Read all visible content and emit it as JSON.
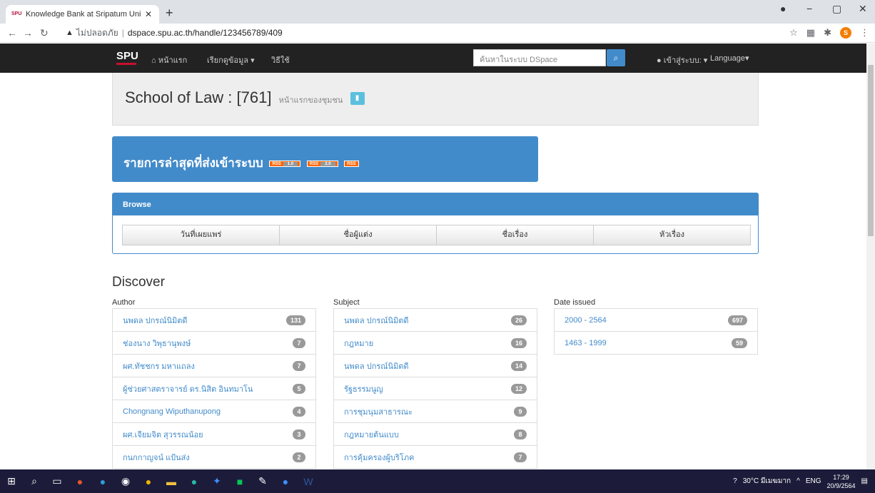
{
  "browser": {
    "tab_title": "Knowledge Bank at Sripatum Uni",
    "tab_favicon": "SPU",
    "insecure_label": "ไม่ปลอดภัย",
    "url": "dspace.spu.ac.th/handle/123456789/409"
  },
  "nav": {
    "logo": "SPU",
    "home": "หน้าแรก",
    "browse": "เรียกดูข้อมูล",
    "help": "วิธีใช้",
    "search_placeholder": "ค้นหาในระบบ DSpace",
    "login": "เข้าสู่ระบบ:",
    "language": "Language"
  },
  "header": {
    "title": "School of Law : [761]",
    "subtitle": "หน้าแรกของชุมชน"
  },
  "recent": {
    "title": "รายการล่าสุดที่ส่งเข้าระบบ",
    "feeds": [
      {
        "label": "RSS",
        "version": "1.0"
      },
      {
        "label": "RSS",
        "version": "2.0"
      }
    ],
    "rss": "RSS"
  },
  "browse": {
    "heading": "Browse",
    "buttons": [
      "วันที่เผยแพร่",
      "ชื่อผู้แต่ง",
      "ชื่อเรื่อง",
      "หัวเรื่อง"
    ]
  },
  "discover": {
    "title": "Discover",
    "author": {
      "label": "Author",
      "items": [
        {
          "name": "นพดล ปกรณ์นิมิตดี",
          "count": "131"
        },
        {
          "name": "ช่องนาง วิพุธานุพงษ์",
          "count": "7"
        },
        {
          "name": "ผศ.ทัชชกร มหาแถลง",
          "count": "7"
        },
        {
          "name": "ผู้ช่วยศาสตราจารย์ ดร.นิสิต อินทมาโน",
          "count": "5"
        },
        {
          "name": "Chongnang Wiputhanupong",
          "count": "4"
        },
        {
          "name": "ผศ.เจียมจิต สุวรรณน้อย",
          "count": "3"
        },
        {
          "name": "กนกกาญจน์ แป้นส่ง",
          "count": "2"
        }
      ]
    },
    "subject": {
      "label": "Subject",
      "items": [
        {
          "name": "นพดล ปกรณ์นิมิตดี",
          "count": "26"
        },
        {
          "name": "กฎหมาย",
          "count": "16"
        },
        {
          "name": "นพดล ปกรณ์นิมิตดี",
          "count": "14"
        },
        {
          "name": "รัฐธรรมนูญ",
          "count": "12"
        },
        {
          "name": "การชุมนุมสาธารณะ",
          "count": "9"
        },
        {
          "name": "กฎหมายต้นแบบ",
          "count": "8"
        },
        {
          "name": "การคุ้มครองผู้บริโภค",
          "count": "7"
        }
      ]
    },
    "date": {
      "label": "Date issued",
      "items": [
        {
          "name": "2000 - 2564",
          "count": "697"
        },
        {
          "name": "1463 - 1999",
          "count": "59"
        }
      ]
    }
  },
  "taskbar": {
    "weather": "30°C มีเมฆมาก",
    "lang": "ENG",
    "time": "17:29",
    "date": "20/9/2564"
  }
}
